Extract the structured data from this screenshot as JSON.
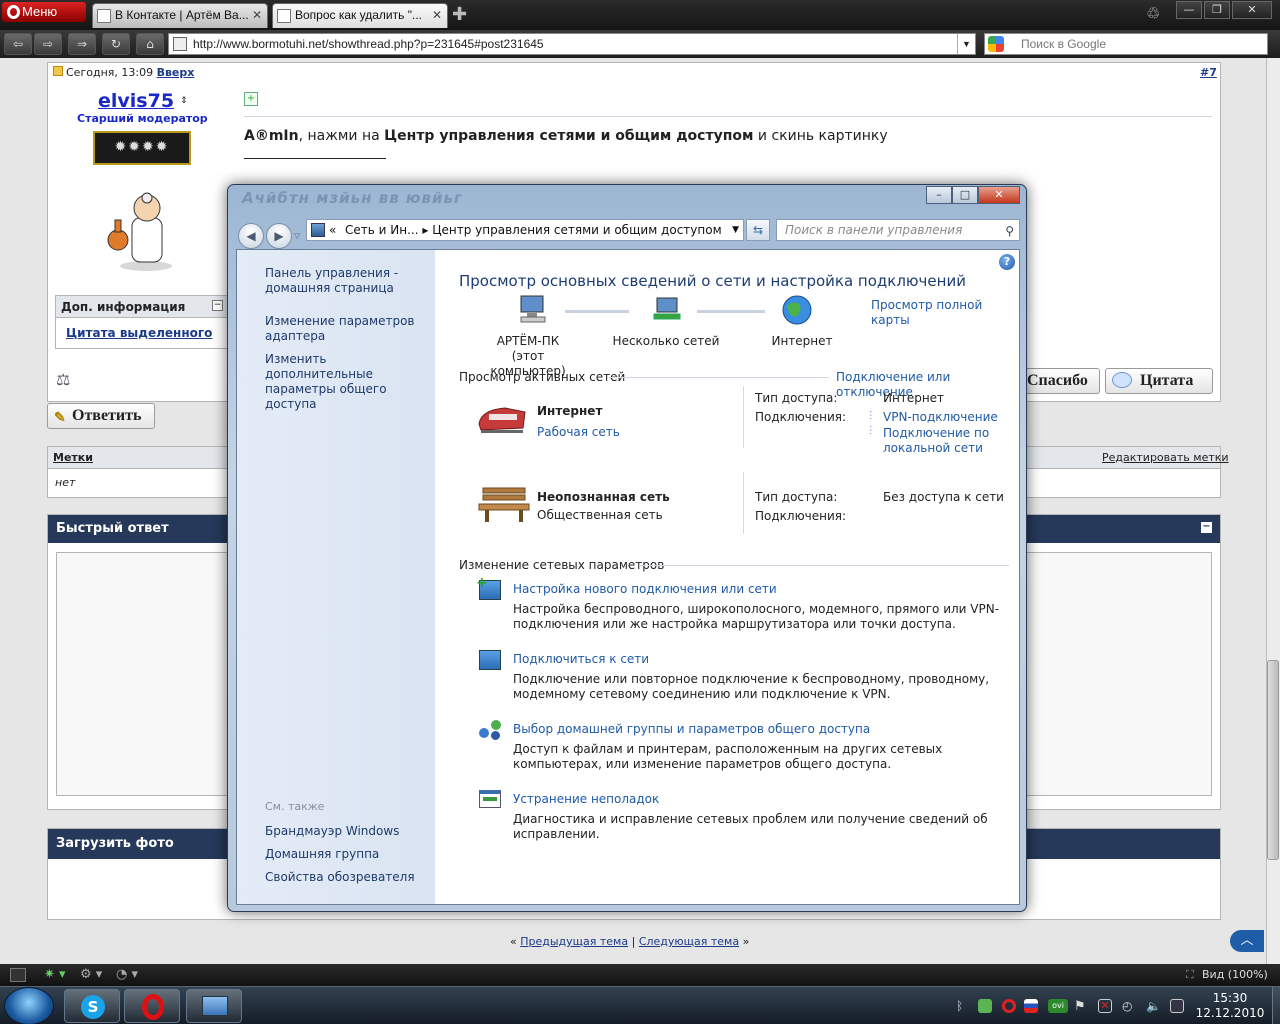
{
  "browser": {
    "menu_label": "Меню",
    "tabs": [
      {
        "label": "В Контакте | Артём Ва..."
      },
      {
        "label": "Вопрос как удалить \"..."
      }
    ],
    "address": "http://www.bormotuhi.net/showthread.php?p=231645#post231645",
    "search_placeholder": "Поиск в Google",
    "zoom": "Вид (100%)"
  },
  "post": {
    "date": "Сегодня, 13:09",
    "top_link": "Вверх",
    "number": "#7",
    "username": "elvis75",
    "rank": "Старший модератор",
    "info_title": "Доп. информация",
    "quote_selected": "Цитата выделенного",
    "message_name": "A®mIn",
    "message_mid": ", нажми на ",
    "message_bold": "Центр управления сетями и общим доступом",
    "message_end": " и скинь картинку",
    "thanks_button": "Спасибо",
    "quote_button": "Цитата",
    "reply_button": "Ответить"
  },
  "tags": {
    "title": "Метки",
    "value": "нет",
    "edit_link": "Редактировать метки"
  },
  "quick_reply": {
    "title": "Быстрый ответ"
  },
  "upload": {
    "title": "Загрузить фото"
  },
  "thread_nav": {
    "prev": "Предыдущая тема",
    "separator": "|",
    "next": "Следующая тема"
  },
  "window": {
    "blurred_title": "Ачйбтн мзйьн вв ювйьг",
    "breadcrumb_1": "Сеть и Ин...",
    "breadcrumb_2": "Центр управления сетями и общим доступом",
    "search_placeholder": "Поиск в панели управления",
    "nav_links": [
      "Панель управления - домашняя страница",
      "Изменение параметров адаптера",
      "Изменить дополнительные параметры общего доступа"
    ],
    "see_also_title": "См. также",
    "see_also": [
      "Брандмауэр Windows",
      "Домашняя группа",
      "Свойства обозревателя"
    ],
    "heading": "Просмотр основных сведений о сети и настройка подключений",
    "full_map": "Просмотр полной карты",
    "map_nodes": [
      {
        "label": "АРТЁМ-ПК",
        "sub": "(этот компьютер)"
      },
      {
        "label": "Несколько сетей",
        "sub": ""
      },
      {
        "label": "Интернет",
        "sub": ""
      }
    ],
    "active_title": "Просмотр активных сетей",
    "connect_link": "Подключение или отключение",
    "networks": [
      {
        "name": "Интернет",
        "type": "Рабочая сеть",
        "access_label": "Тип доступа:",
        "access": "Интернет",
        "conn_label": "Подключения:",
        "conn_1": "VPN-подключение",
        "conn_2": "Подключение по локальной сети"
      },
      {
        "name": "Неопознанная сеть",
        "type": "Общественная сеть",
        "access_label": "Тип доступа:",
        "access": "Без доступа к сети",
        "conn_label": "Подключения:"
      }
    ],
    "change_title": "Изменение сетевых параметров",
    "tasks": [
      {
        "title": "Настройка нового подключения или сети",
        "desc": "Настройка беспроводного, широкополосного, модемного, прямого или VPN-подключения или же настройка маршрутизатора или точки доступа."
      },
      {
        "title": "Подключиться к сети",
        "desc": "Подключение или повторное подключение к беспроводному, проводному, модемному сетевому соединению или подключение к VPN."
      },
      {
        "title": "Выбор домашней группы и параметров общего доступа",
        "desc": "Доступ к файлам и принтерам, расположенным на других сетевых компьютерах, или изменение параметров общего доступа."
      },
      {
        "title": "Устранение неполадок",
        "desc": "Диагностика и исправление сетевых проблем или получение сведений об исправлении."
      }
    ]
  },
  "taskbar": {
    "time": "15:30",
    "date": "12.12.2010"
  },
  "colors": {
    "link_blue": "#1f5aa8",
    "forum_dark": "#26395a",
    "opera_red": "#cc1111"
  }
}
